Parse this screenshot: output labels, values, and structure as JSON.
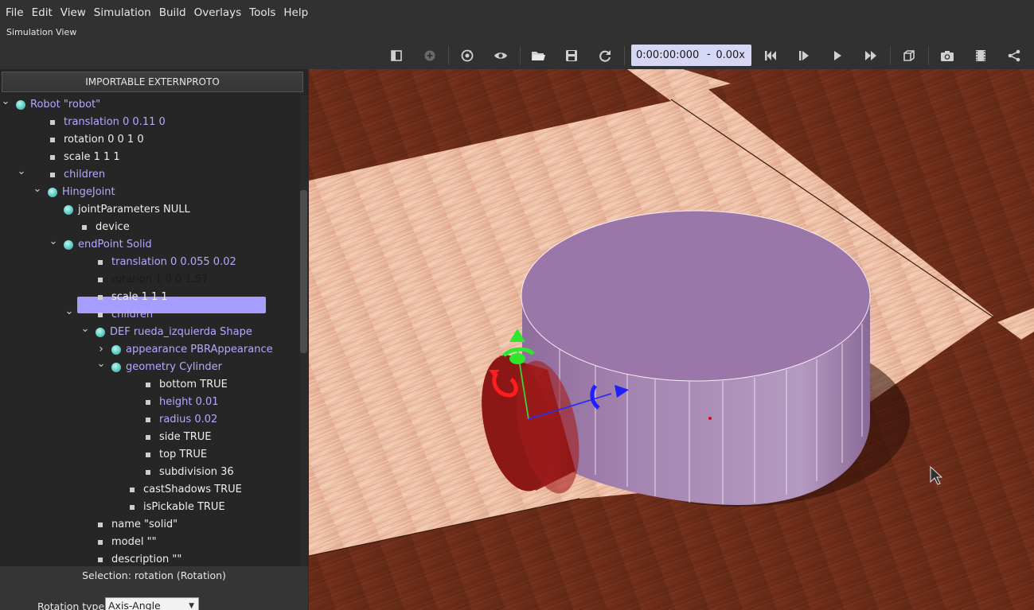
{
  "menu": {
    "file": "File",
    "edit": "Edit",
    "view": "View",
    "simulation": "Simulation",
    "build": "Build",
    "overlays": "Overlays",
    "tools": "Tools",
    "help": "Help"
  },
  "simulation_view": {
    "title": "Simulation View"
  },
  "toolbar": {
    "time": "0:00:00:000",
    "separator": "-",
    "speed": "0.00x",
    "icons": [
      "toggle-scene-tree-icon",
      "add-node-icon",
      "reset-viewpoint-icon",
      "eye-icon",
      "open-world-icon",
      "save-world-icon",
      "reload-world-icon",
      "step-back-icon",
      "step-icon",
      "play-icon",
      "fast-forward-icon",
      "view-cube-icon",
      "screenshot-icon",
      "record-video-icon",
      "share-icon"
    ]
  },
  "scene_tree": {
    "import_button": "IMPORTABLE EXTERNPROTO",
    "rows": [
      {
        "label": "Robot \"robot\"",
        "color": "purple"
      },
      {
        "label": "translation 0 0.11 0",
        "color": "purple"
      },
      {
        "label": "rotation 0 0 1 0",
        "color": "white"
      },
      {
        "label": "scale 1 1 1",
        "color": "white"
      },
      {
        "label": "children",
        "color": "purple"
      },
      {
        "label": "HingeJoint",
        "color": "purple"
      },
      {
        "label": "jointParameters NULL",
        "color": "white"
      },
      {
        "label": "device",
        "color": "white"
      },
      {
        "label": "endPoint Solid",
        "color": "purple"
      },
      {
        "label": "translation 0 0.055 0.02",
        "color": "purple"
      },
      {
        "label": "rotation 1 0 0 1.57",
        "color": "white",
        "selected": true
      },
      {
        "label": "scale 1 1 1",
        "color": "white"
      },
      {
        "label": "children",
        "color": "purple"
      },
      {
        "label": "DEF rueda_izquierda Shape",
        "color": "purple"
      },
      {
        "label": "appearance PBRAppearance",
        "color": "purple"
      },
      {
        "label": "geometry Cylinder",
        "color": "purple"
      },
      {
        "label": "bottom TRUE",
        "color": "white"
      },
      {
        "label": "height 0.01",
        "color": "purple"
      },
      {
        "label": "radius 0.02",
        "color": "purple"
      },
      {
        "label": "side TRUE",
        "color": "white"
      },
      {
        "label": "top TRUE",
        "color": "white"
      },
      {
        "label": "subdivision 36",
        "color": "white"
      },
      {
        "label": "castShadows TRUE",
        "color": "white"
      },
      {
        "label": "isPickable TRUE",
        "color": "white"
      },
      {
        "label": "name \"solid\"",
        "color": "white"
      },
      {
        "label": "model \"\"",
        "color": "white"
      },
      {
        "label": "description \"\"",
        "color": "white"
      }
    ]
  },
  "field_editor": {
    "selection": "Selection: rotation (Rotation)",
    "rotation_type_label": "Rotation type:",
    "rotation_type_value": "Axis-Angle"
  },
  "colors": {
    "accent_selection": "#a79cff",
    "purple_text": "#b6a8ff",
    "time_box_bg": "#d5d7f5",
    "robot_body": "#9b76a8",
    "wheel": "#9a1a1a"
  }
}
